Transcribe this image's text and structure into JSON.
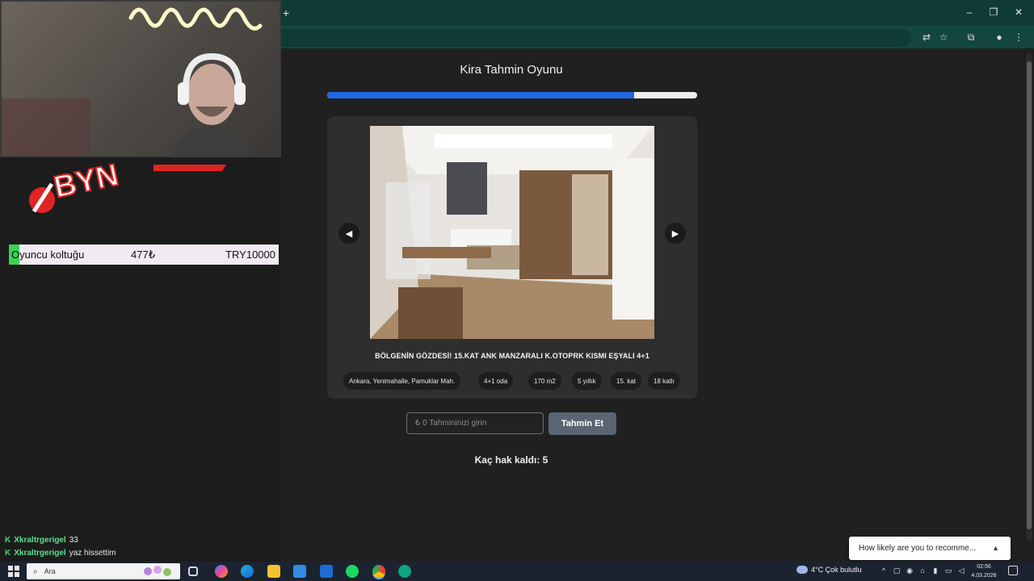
{
  "overlay": {
    "seat_label_first": "O",
    "seat_label_rest": "yuncu koltuğu",
    "seat_amount": "477₺",
    "seat_total": "TRY10000",
    "chat": [
      {
        "badge": "K",
        "user": "Xkraltrgerigel",
        "message": "33"
      },
      {
        "badge": "K",
        "user": "Xkraltrgerigel",
        "message": "yaz hissettim"
      }
    ]
  },
  "browser": {
    "newtab_glyph": "+",
    "controls": {
      "minimize": "–",
      "maximize": "❐",
      "close": "✕"
    },
    "toolbar_icons": [
      "translate-icon",
      "star-icon",
      "extensions-icon",
      "profile-icon",
      "more-icon"
    ]
  },
  "game": {
    "title": "Kira Tahmin Oyunu",
    "progress_fraction": 0.83,
    "listing_title": "BÖLGENİN GÖZDESİ! 15.KAT ANK MANZARALI K.OTOPRK KISMI EŞYALI 4+1",
    "chips": [
      "Ankara, Yenimahalle, Pamuklar Mah.",
      "4+1 oda",
      "170 m2",
      "5 yıllık",
      "15. kat",
      "18 katlı"
    ],
    "prev_glyph": "◀",
    "next_glyph": "▶",
    "guess_placeholder": "₺ 0 Tahmininizi girin",
    "guess_button": "Tahmin Et",
    "remaining": "Kaç hak kaldı: 5"
  },
  "toast": {
    "text": "How likely are you to recomme...",
    "caret": "▲"
  },
  "taskbar": {
    "search_placeholder": "Ara",
    "weather": "4°C  Çok bulutlu",
    "time": "02:56",
    "date": "4.03.2026"
  }
}
